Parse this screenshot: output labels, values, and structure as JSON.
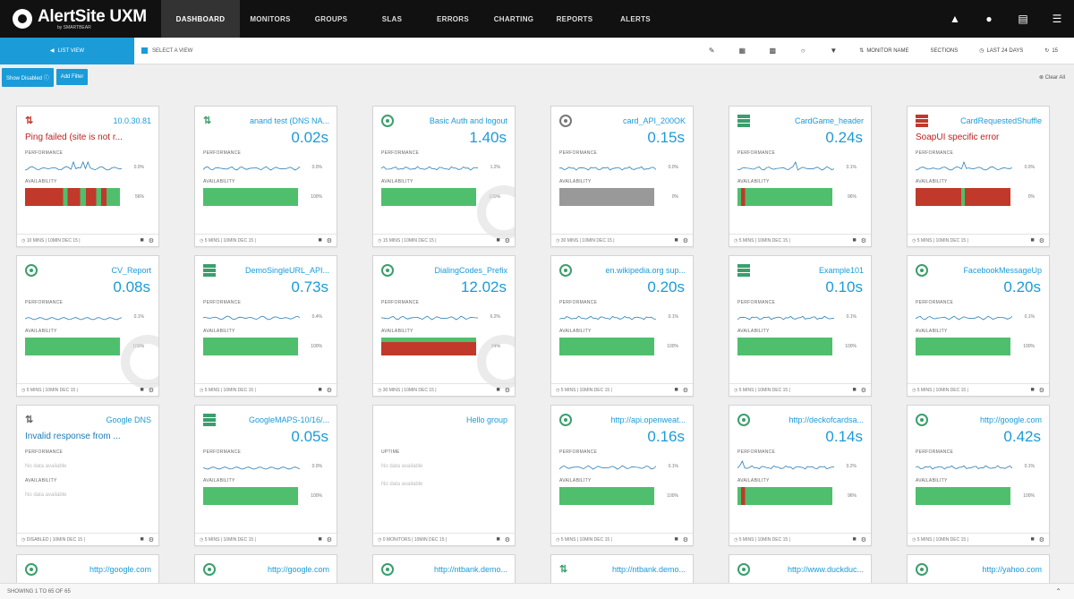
{
  "app": {
    "title": "AlertSite UXM",
    "subtitle": "by SMARTBEAR"
  },
  "nav": {
    "items": [
      "DASHBOARD",
      "MONITORS",
      "GROUPS",
      "SLAS",
      "ERRORS",
      "CHARTING",
      "REPORTS",
      "ALERTS"
    ],
    "active": 0
  },
  "toolbar": {
    "left_button": "LIST VIEW",
    "select_view": "SELECT A VIEW",
    "monitor_name": "MONITOR NAME",
    "sections": "SECTIONS",
    "last_hours": "LAST 24 DAYS",
    "refresh": "15"
  },
  "filters": {
    "show_disabled": "Show Disabled",
    "add_filter": "Add Filter",
    "clear_all": "Clear All"
  },
  "footer_text": "SHOWING 1 TO 65 OF 65",
  "colors": {
    "accent": "#1b9bd8",
    "success": "#4fbf6d",
    "error": "#c0392b",
    "nodata": "#999999"
  },
  "perf_label": "PERFORMANCE",
  "avail_label": "AVAILABILITY",
  "monitors": [
    {
      "name": "10.0.30.81",
      "icon": "arrows-red-icon",
      "error": "Ping failed (site is not r...",
      "perf": "0.0%",
      "avail": "56%",
      "avail_fraction": 0.56,
      "avail_mode": "mixed",
      "foot": "10 MINS | 10MIN DEC 15 |"
    },
    {
      "name": "anand test (DNS NA...",
      "icon": "arrows-green-icon",
      "value": "0.02s",
      "perf": "0.0%",
      "avail": "100%",
      "avail_fraction": 1,
      "avail_mode": "ok",
      "foot": "5 MINS | 10MIN DEC 15 |"
    },
    {
      "name": "Basic Auth and logout",
      "icon": "globe-green-icon",
      "value": "1.40s",
      "perf": "1.2%",
      "avail": "100%",
      "avail_fraction": 1,
      "avail_mode": "ok",
      "foot": "15 MINS | 10MIN DEC 15 |"
    },
    {
      "name": "card_API_200OK",
      "icon": "globe-gray-icon",
      "value": "0.15s",
      "perf": "0.0%",
      "avail": "0%",
      "avail_fraction": 0,
      "avail_mode": "nodata",
      "foot": "30 MINS | 10MIN DEC 15 |"
    },
    {
      "name": "CardGame_header",
      "icon": "stack-green-icon",
      "value": "0.24s",
      "perf": "0.1%",
      "avail": "96%",
      "avail_fraction": 0.96,
      "avail_mode": "spike",
      "foot": "5 MINS | 10MIN DEC 15 |"
    },
    {
      "name": "CardRequestedShuffle",
      "icon": "stack-red-icon",
      "error": "SoapUI specific error",
      "perf": "0.0%",
      "avail": "0%",
      "avail_fraction": 0,
      "avail_mode": "mixed2",
      "foot": "5 MINS | 10MIN DEC 15 |"
    },
    {
      "name": "CV_Report",
      "icon": "globe-green-icon",
      "value": "0.08s",
      "perf": "0.1%",
      "avail": "100%",
      "avail_fraction": 1,
      "avail_mode": "ok",
      "foot": "5 MINS | 10MIN DEC 15 |"
    },
    {
      "name": "DemoSingleURL_API...",
      "icon": "stack-green-icon",
      "value": "0.73s",
      "perf": "0.4%",
      "avail": "100%",
      "avail_fraction": 1,
      "avail_mode": "ok",
      "foot": "5 MINS | 10MIN DEC 15 |"
    },
    {
      "name": "DialingCodes_Prefix",
      "icon": "globe-green-icon",
      "value": "12.02s",
      "perf": "6.2%",
      "avail": "84%",
      "avail_fraction": 0.84,
      "avail_mode": "partial",
      "foot": "30 MINS | 10MIN DEC 15 |"
    },
    {
      "name": "en.wikipedia.org sup...",
      "icon": "globe-green-icon",
      "value": "0.20s",
      "perf": "0.1%",
      "avail": "100%",
      "avail_fraction": 1,
      "avail_mode": "ok",
      "foot": "5 MINS | 10MIN DEC 15 |"
    },
    {
      "name": "Example101",
      "icon": "stack-green-icon",
      "value": "0.10s",
      "perf": "0.1%",
      "avail": "100%",
      "avail_fraction": 1,
      "avail_mode": "ok",
      "foot": "5 MINS | 10MIN DEC 15 |"
    },
    {
      "name": "FacebookMessageUp",
      "icon": "globe-green-icon",
      "value": "0.20s",
      "perf": "0.1%",
      "avail": "100%",
      "avail_fraction": 1,
      "avail_mode": "ok",
      "foot": "5 MINS | 10MIN DEC 15 |"
    },
    {
      "name": "Google DNS",
      "icon": "arrows-gray-icon",
      "invalid": "Invalid response from ...",
      "perf_nodata": "No data available",
      "avail_nodata": "No data available",
      "foot": "DISABLED | 10MIN DEC 15 |"
    },
    {
      "name": "GoogleMAPS-10/16/...",
      "icon": "stack-green-icon",
      "value": "0.05s",
      "perf": "0.0%",
      "avail": "100%",
      "avail_fraction": 1,
      "avail_mode": "ok",
      "foot": "5 MINS | 10MIN DEC 15 |"
    },
    {
      "name": "Hello group",
      "icon": "none",
      "group": true,
      "uptime_label": "UPTIME",
      "perf_nodata": "No data available",
      "avail_nodata": "No data available",
      "foot": "0 MONITORS | 10MIN DEC 15 |"
    },
    {
      "name": "http://api.openweat...",
      "icon": "globe-green-icon",
      "value": "0.16s",
      "perf": "0.1%",
      "avail": "100%",
      "avail_fraction": 1,
      "avail_mode": "ok",
      "foot": "5 MINS | 10MIN DEC 15 |"
    },
    {
      "name": "http://deckofcardsa...",
      "icon": "globe-green-icon",
      "value": "0.14s",
      "perf": "0.2%",
      "avail": "96%",
      "avail_fraction": 0.96,
      "avail_mode": "spike",
      "foot": "5 MINS | 10MIN DEC 15 |"
    },
    {
      "name": "http://google.com",
      "icon": "globe-green-icon",
      "value": "0.42s",
      "perf": "0.1%",
      "avail": "100%",
      "avail_fraction": 1,
      "avail_mode": "ok",
      "foot": "5 MINS | 10MIN DEC 15 |"
    },
    {
      "name": "http://google.com",
      "icon": "globe-green-icon"
    },
    {
      "name": "http://google.com",
      "icon": "globe-green-icon"
    },
    {
      "name": "http://ntbank.demo...",
      "icon": "globe-green-icon"
    },
    {
      "name": "http://ntbank.demo...",
      "icon": "arrows-green-icon"
    },
    {
      "name": "http://www.duckduc...",
      "icon": "globe-green-icon"
    },
    {
      "name": "http://yahoo.com",
      "icon": "globe-green-icon"
    }
  ]
}
